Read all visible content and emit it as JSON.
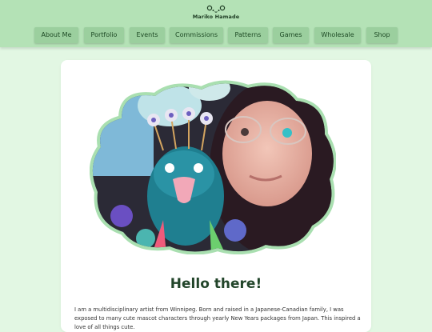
{
  "header": {
    "logo_text": "Mariko Hamade",
    "logo_mark": "ᕦ•ᴥ•ᕤ"
  },
  "nav": [
    {
      "label": "About Me"
    },
    {
      "label": "Portfolio"
    },
    {
      "label": "Events"
    },
    {
      "label": "Commissions"
    },
    {
      "label": "Patterns"
    },
    {
      "label": "Games"
    },
    {
      "label": "Wholesale"
    },
    {
      "label": "Shop"
    }
  ],
  "main": {
    "heading": "Hello there!",
    "intro": "I am a multidisciplinary artist from Winnipeg. Born and raised in a Japanese-Canadian family, I was exposed to many cute mascot characters through yearly New Years packages from Japan. This inspired a love of all things cute."
  },
  "colors": {
    "header_bg": "#b4e2b6",
    "nav_button_bg": "#9bcf9e",
    "page_bg": "#e2f7e3",
    "frame_border": "#a9dfb0",
    "heading_text": "#22452a"
  }
}
